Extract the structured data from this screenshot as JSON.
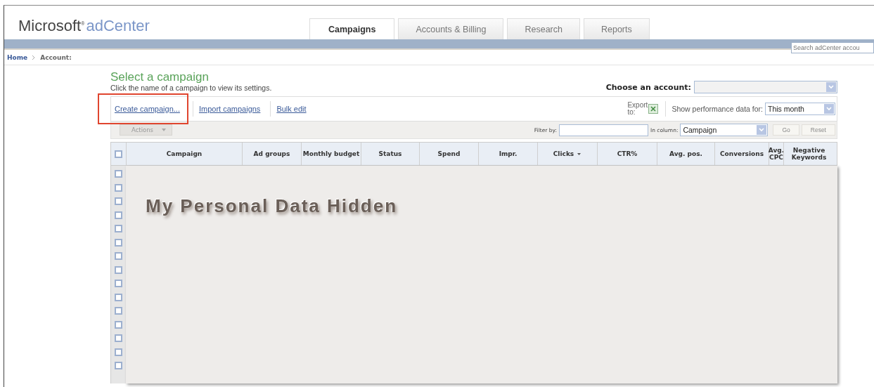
{
  "header": {
    "brand": "Microsoft$^{®}$",
    "product": "adCenter"
  },
  "tabs": [
    {
      "label": "Campaigns",
      "selected": true
    },
    {
      "label": "Accounts & Billing",
      "selected": false
    },
    {
      "label": "Research",
      "selected": false
    },
    {
      "label": "Reports",
      "selected": false
    }
  ],
  "search": {
    "placeholder": "Search adCenter accou"
  },
  "breadcrumb": [
    "Home",
    "Account:"
  ],
  "page": {
    "title": "Select a campaign",
    "subtitle": "Click the name of a campaign to view its settings."
  },
  "account_picker": {
    "label": "Choose an account:"
  },
  "toolbar": {
    "links": [
      {
        "label": "Create campaign...",
        "highlighted": true
      },
      {
        "label": "Import campaigns",
        "highlighted": false
      },
      {
        "label": "Bulk edit",
        "highlighted": false
      }
    ],
    "export_label": "Export to:",
    "period_label": "Show performance data for:",
    "period_value": "This month"
  },
  "filter_bar": {
    "actions": "Actions",
    "filter_label": "Filter by:",
    "column_label": "In column:",
    "column_value": "Campaign",
    "buttons": [
      {
        "label": "Go",
        "disabled": true
      },
      {
        "label": "Reset",
        "disabled": true
      }
    ]
  },
  "table": {
    "select_all": {
      "checked": false
    },
    "columns": [
      {
        "label": "Campaign",
        "sorted": false
      },
      {
        "label": "Ad groups",
        "sorted": false
      },
      {
        "label": "Monthly budget",
        "sorted": false
      },
      {
        "label": "Status",
        "sorted": false
      },
      {
        "label": "Spend",
        "sorted": false
      },
      {
        "label": "Impr.",
        "sorted": false
      },
      {
        "label": "Clicks",
        "sorted": true
      },
      {
        "label": "CTR%",
        "sorted": false
      },
      {
        "label": "Avg. pos.",
        "sorted": false
      },
      {
        "label": "Conversions",
        "sorted": false
      },
      {
        "label": "Avg. CPC",
        "sorted": false
      },
      {
        "label": "Negative Keywords",
        "sorted": false
      }
    ],
    "rows": [
      {
        "checked": false
      },
      {
        "checked": false
      },
      {
        "checked": false
      },
      {
        "checked": false
      },
      {
        "checked": false
      },
      {
        "checked": false
      },
      {
        "checked": false
      },
      {
        "checked": false
      },
      {
        "checked": false
      },
      {
        "checked": false
      },
      {
        "checked": false
      },
      {
        "checked": false
      },
      {
        "checked": false
      },
      {
        "checked": false
      },
      {
        "checked": false
      }
    ],
    "overlay": {
      "label": "My Personal Data Hidden"
    }
  }
}
